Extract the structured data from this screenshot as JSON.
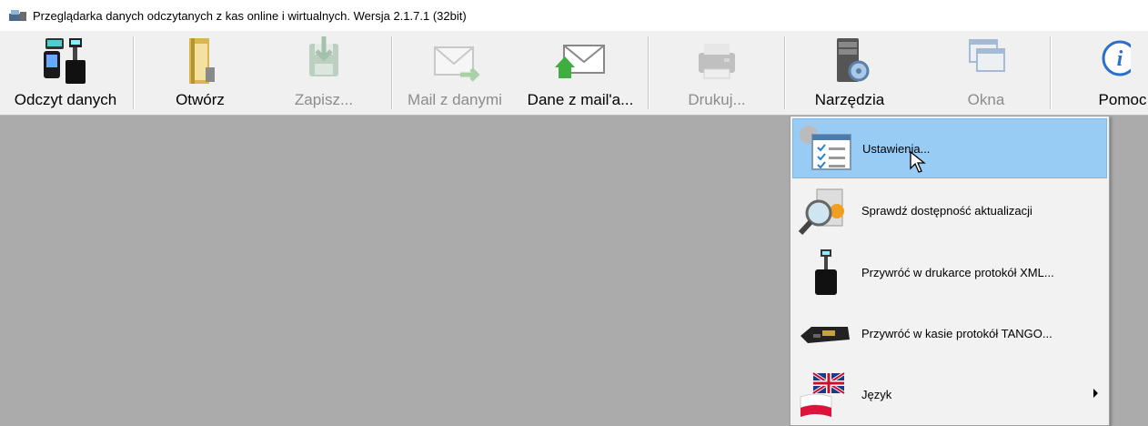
{
  "window": {
    "title": "Przeglądarka danych odczytanych z kas online i wirtualnych. Wersja 2.1.7.1 (32bit)"
  },
  "toolbar": {
    "buttons": [
      {
        "label": "Odczyt danych",
        "icon": "cash-register-icon",
        "enabled": true
      },
      {
        "label": "Otwórz",
        "icon": "folder-icon",
        "enabled": true
      },
      {
        "label": "Zapisz...",
        "icon": "save-icon",
        "enabled": false
      },
      {
        "label": "Mail z danymi",
        "icon": "mail-send-icon",
        "enabled": false
      },
      {
        "label": "Dane z mail'a...",
        "icon": "mail-receive-icon",
        "enabled": true
      },
      {
        "label": "Drukuj...",
        "icon": "printer-icon",
        "enabled": false
      },
      {
        "label": "Narzędzia",
        "icon": "tools-server-icon",
        "enabled": true
      },
      {
        "label": "Okna",
        "icon": "windows-icon",
        "enabled": false
      },
      {
        "label": "Pomoc",
        "icon": "info-icon",
        "enabled": true
      }
    ]
  },
  "menu": {
    "items": [
      {
        "label": "Ustawienia...",
        "icon": "settings-icon",
        "highlighted": true
      },
      {
        "label": "Sprawdź dostępność aktualizacji",
        "icon": "magnifier-update-icon",
        "highlighted": false
      },
      {
        "label": "Przywróć w drukarce protokół XML...",
        "icon": "fiscal-printer-icon",
        "highlighted": false
      },
      {
        "label": "Przywróć w kasie protokół TANGO...",
        "icon": "cash-terminal-icon",
        "highlighted": false
      },
      {
        "label": "Język",
        "icon": "language-flags-icon",
        "highlighted": false,
        "has_submenu": true
      }
    ]
  },
  "colors": {
    "toolbar_bg": "#f0f0f0",
    "workspace_bg": "#ababab",
    "menu_bg": "#f2f2f2",
    "menu_highlight": "#99ccf5"
  }
}
